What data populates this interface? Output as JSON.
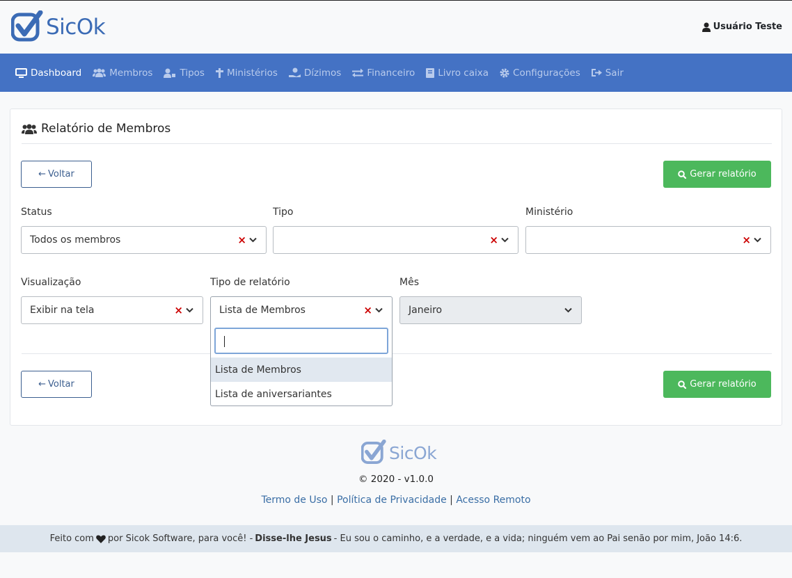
{
  "brand": {
    "name": "SicOk",
    "accent": "#4472c4",
    "logo_color": "#3b6bb5"
  },
  "header": {
    "user_name": "Usuário Teste",
    "user_icon": "user-icon"
  },
  "nav": {
    "items": [
      {
        "label": "Dashboard",
        "icon": "desktop-icon",
        "active": true
      },
      {
        "label": "Membros",
        "icon": "users-icon"
      },
      {
        "label": "Tipos",
        "icon": "user-tag-icon"
      },
      {
        "label": "Ministérios",
        "icon": "cross-icon"
      },
      {
        "label": "Dízimos",
        "icon": "hand-coin-icon"
      },
      {
        "label": "Financeiro",
        "icon": "exchange-icon"
      },
      {
        "label": "Livro caixa",
        "icon": "book-icon"
      },
      {
        "label": "Configurações",
        "icon": "gear-icon"
      },
      {
        "label": "Sair",
        "icon": "sign-out-icon"
      }
    ]
  },
  "page": {
    "title": "Relatório de Membros",
    "back_label": "Voltar",
    "generate_label": "Gerar relatório",
    "generate_color": "#4cb85c"
  },
  "filters": {
    "status": {
      "label": "Status",
      "value": "Todos os membros"
    },
    "tipo": {
      "label": "Tipo",
      "value": ""
    },
    "ministerio": {
      "label": "Ministério",
      "value": ""
    },
    "visualizacao": {
      "label": "Visualização",
      "value": "Exibir na tela"
    },
    "tipo_relatorio": {
      "label": "Tipo de relatório",
      "value": "Lista de Membros",
      "search_value": "",
      "options": [
        "Lista de Membros",
        "Lista de aniversariantes"
      ],
      "highlighted": "Lista de Membros"
    },
    "mes": {
      "label": "Mês",
      "value": "Janeiro",
      "disabled": true
    }
  },
  "footer": {
    "brand": "SicOk",
    "copyright": "© 2020 - v1.0.0",
    "links": [
      "Termo de Uso",
      "Política de Privacidade",
      "Acesso Remoto"
    ],
    "separator": "|",
    "tagline_prefix": "Feito com",
    "tagline_heart_icon": "heart-icon",
    "tagline_mid": "por Sicok Software, para você! -",
    "tagline_bold": "Disse-lhe Jesus",
    "tagline_quote": "- Eu sou o caminho, e a verdade, e a vida; ninguém vem ao Pai senão por mim, João 14:6."
  }
}
